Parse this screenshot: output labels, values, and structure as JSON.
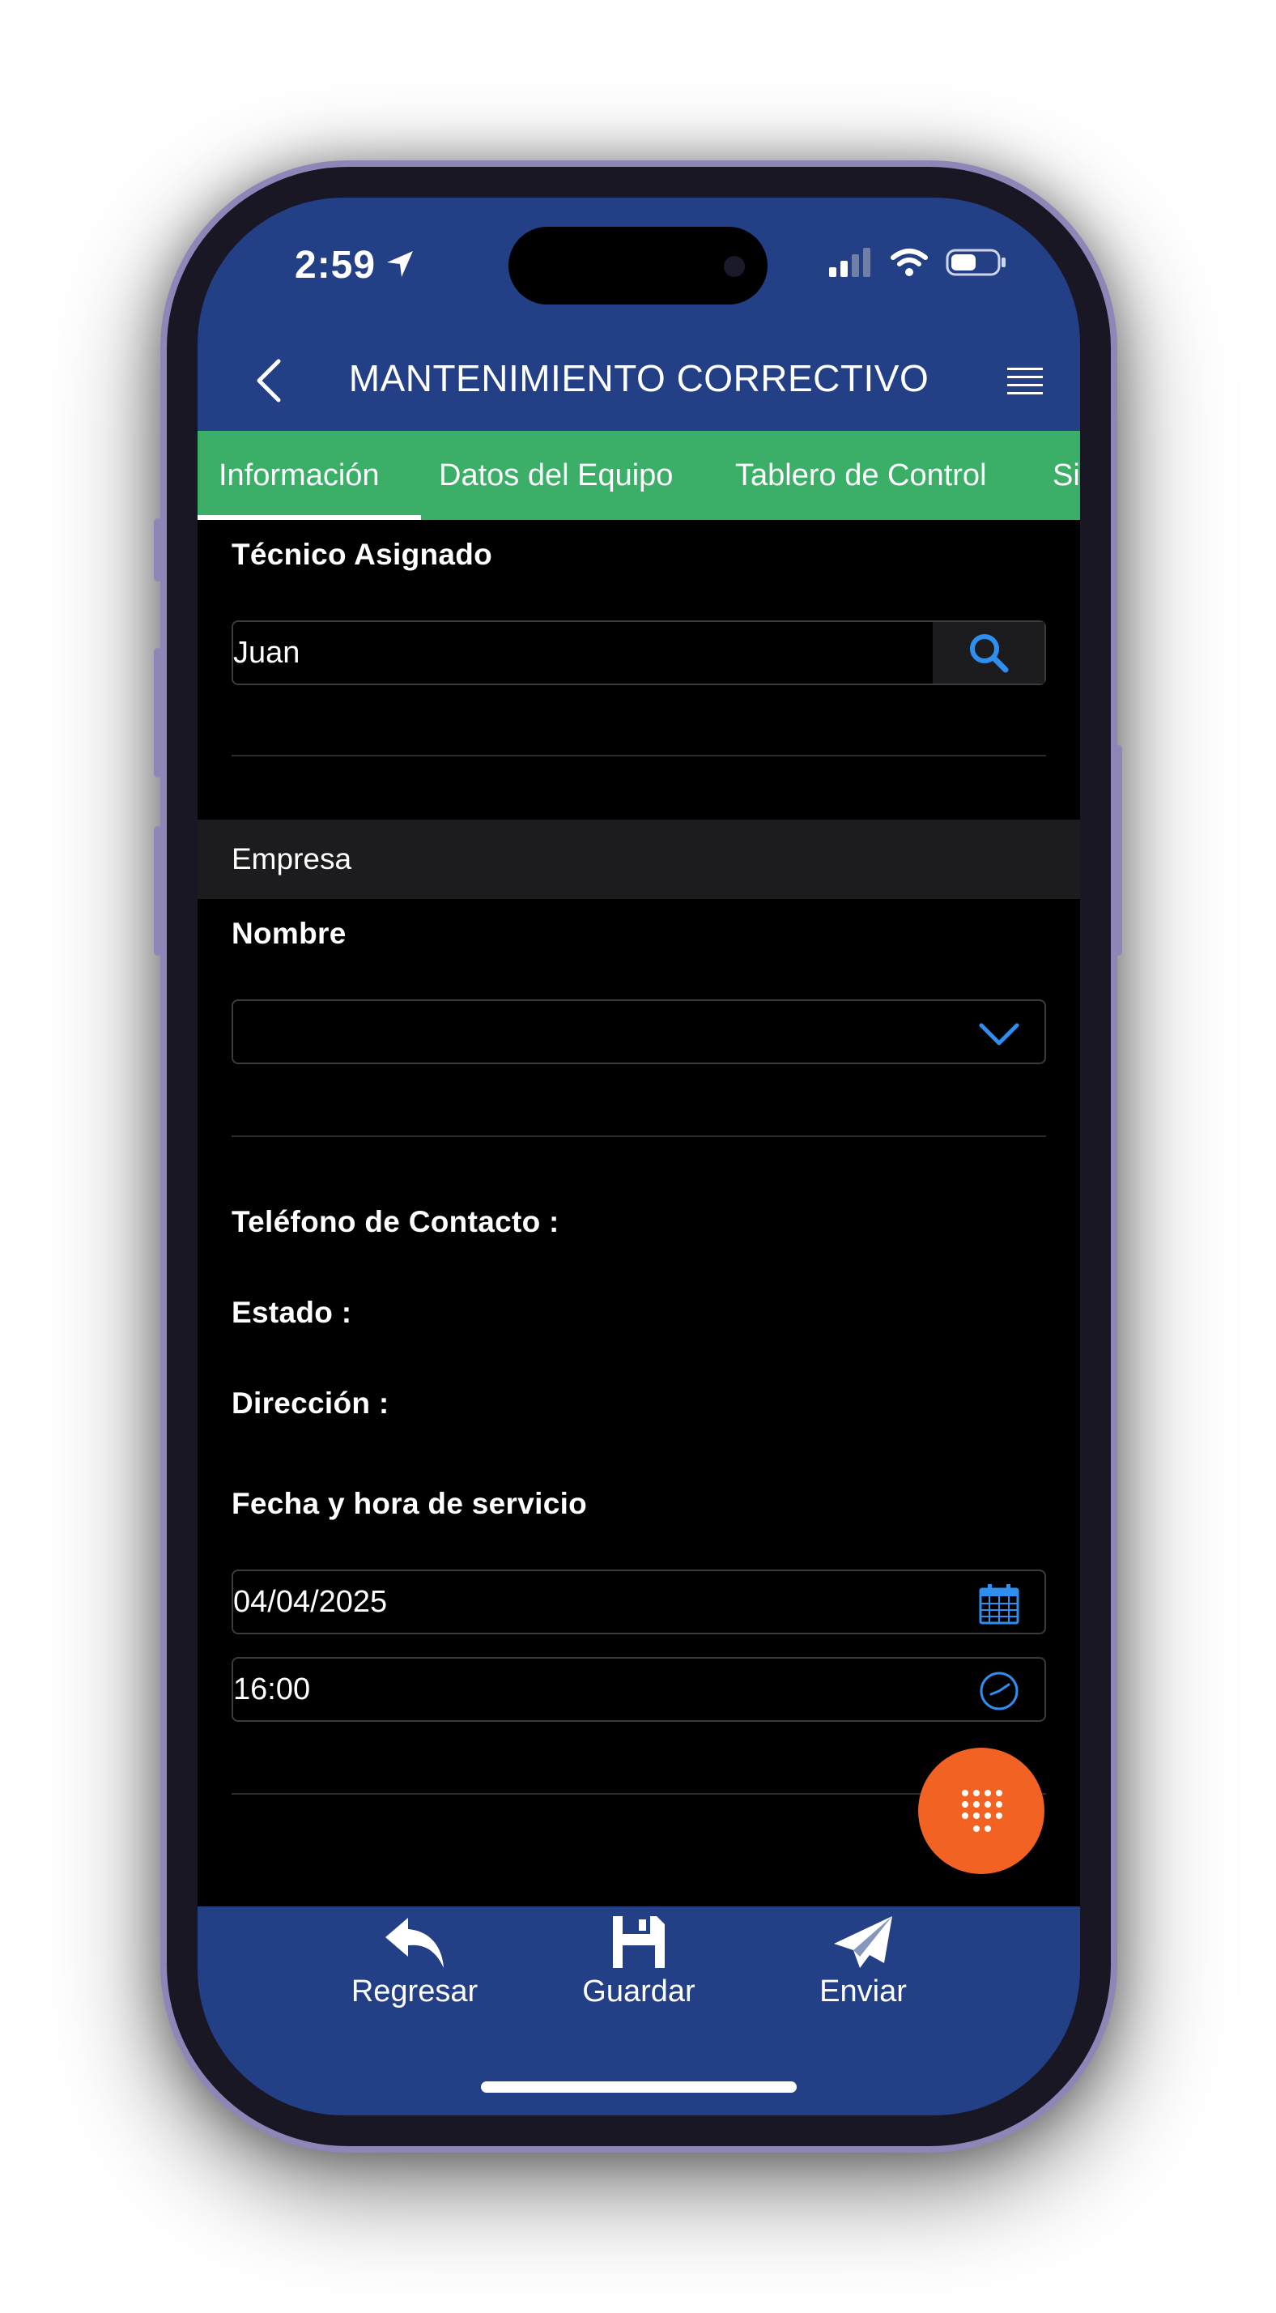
{
  "status_bar": {
    "time": "2:59"
  },
  "header": {
    "title": "MANTENIMIENTO CORRECTIVO"
  },
  "tabs": [
    {
      "label": "Información",
      "active": true
    },
    {
      "label": "Datos del Equipo",
      "active": false
    },
    {
      "label": "Tablero de Control",
      "active": false
    },
    {
      "label": "Si",
      "active": false
    }
  ],
  "tecnico": {
    "label": "Técnico Asignado",
    "value": "Juan"
  },
  "empresa": {
    "section_title": "Empresa",
    "nombre_label": "Nombre",
    "nombre_value": ""
  },
  "info": {
    "telefono_label": "Teléfono de Contacto :",
    "estado_label": "Estado :",
    "direccion_label": "Dirección :"
  },
  "servicio": {
    "label": "Fecha y hora de servicio",
    "date": "04/04/2025",
    "time": "16:00"
  },
  "bottom_bar": {
    "back_label": "Regresar",
    "save_label": "Guardar",
    "send_label": "Enviar"
  },
  "colors": {
    "header_bg": "#233f86",
    "tab_bg": "#3baf68",
    "accent_blue": "#2f8ff0",
    "fab": "#f26222"
  }
}
